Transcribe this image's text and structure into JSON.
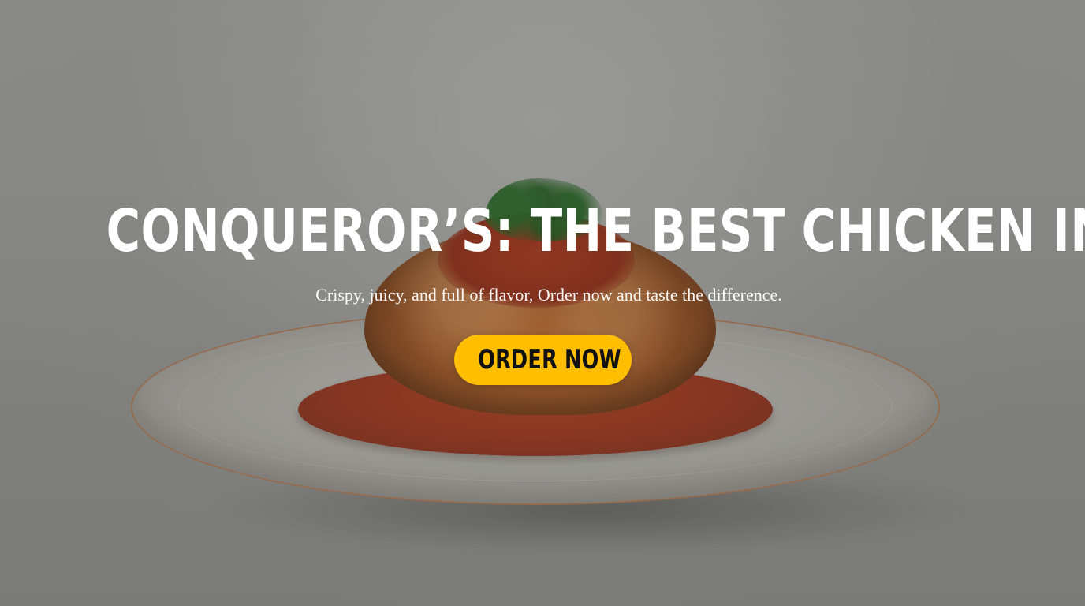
{
  "hero": {
    "title": "CONQUEROR’S: THE BEST CHICKEN IN TOWN",
    "subtitle": "Crispy, juicy, and full of flavor, Order now and taste the difference.",
    "cta_label": "ORDER NOW"
  },
  "colors": {
    "cta_background": "#ffbf00",
    "title_text": "#ffffff",
    "cta_text": "#111111"
  },
  "icons": {
    "background_image": "plated-fried-chicken-photo"
  }
}
